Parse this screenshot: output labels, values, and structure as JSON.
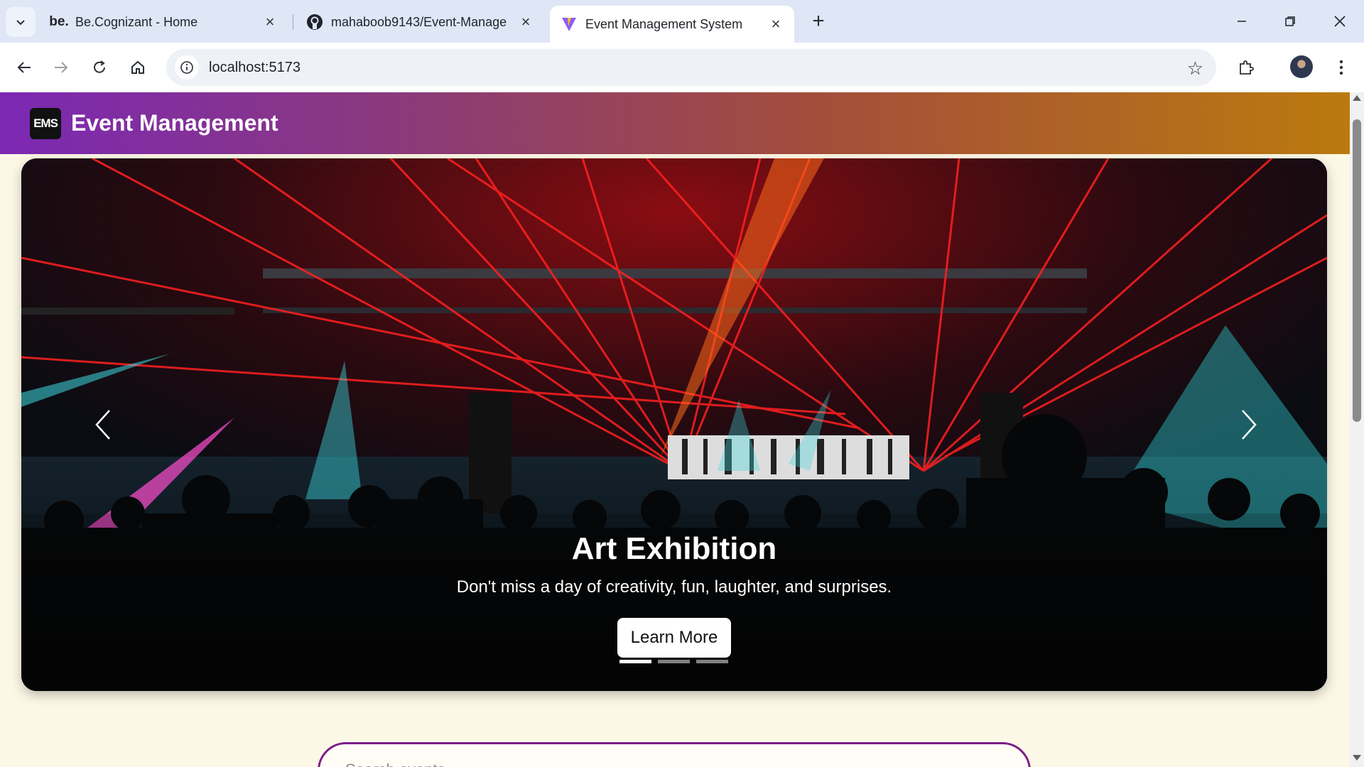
{
  "browser": {
    "tabs": [
      {
        "favicon_text": "be.",
        "favicon": "be-cognizant-icon",
        "title": "Be.Cognizant - Home",
        "active": false
      },
      {
        "favicon": "github-icon",
        "title": "mahaboob9143/Event-Manage",
        "active": false
      },
      {
        "favicon": "vite-icon",
        "title": "Event Management System",
        "active": true
      }
    ],
    "url": "localhost:5173"
  },
  "page": {
    "logo_text": "EMS",
    "brand": "Event Management",
    "carousel": {
      "title": "Art Exhibition",
      "subtitle": "Don't miss a day of creativity, fun, laughter, and surprises.",
      "button": "Learn More",
      "slides_total": 3,
      "active_slide": 1
    },
    "search": {
      "placeholder": "Search events..."
    }
  },
  "colors": {
    "navbar_start": "#7c28b4",
    "navbar_end": "#bb7a0e",
    "search_border": "#7b1d8a",
    "page_bg": "#fdf8e6"
  }
}
